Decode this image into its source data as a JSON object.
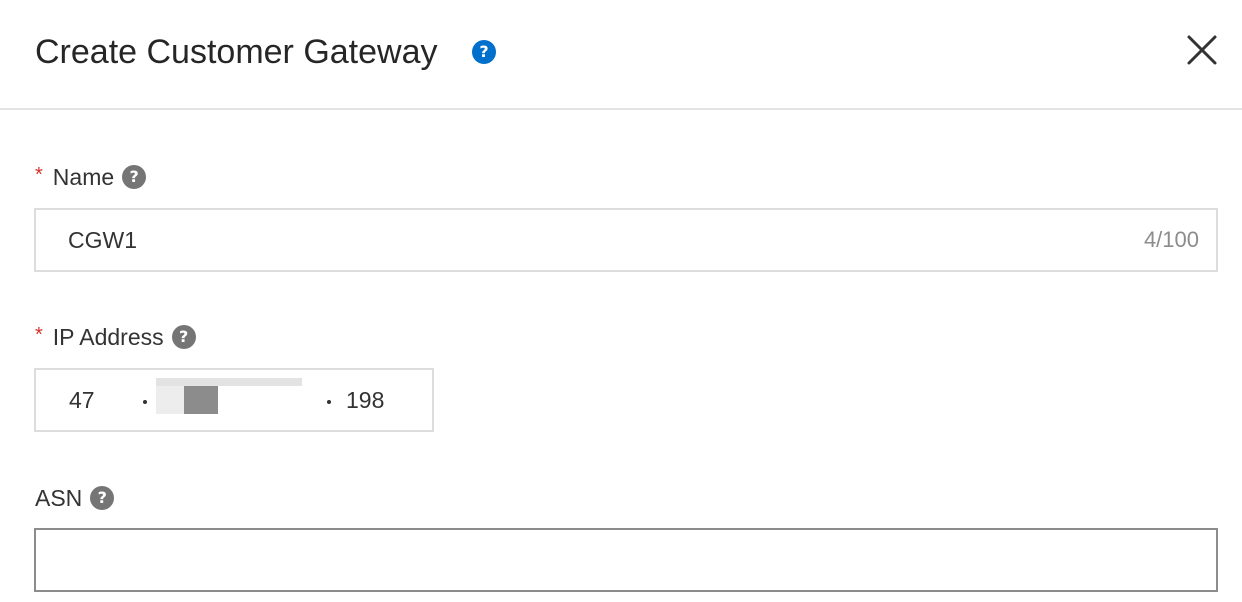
{
  "dialog": {
    "title": "Create Customer Gateway",
    "help_icon": "question-circle-icon",
    "close_icon": "close-icon",
    "accent_color": "#0070cc"
  },
  "form": {
    "name": {
      "label": "Name",
      "required": "*",
      "value": "CGW1",
      "counter": "4/100"
    },
    "ip_address": {
      "label": "IP Address",
      "required": "*",
      "segments": [
        "47",
        "",
        "",
        "198"
      ]
    },
    "asn": {
      "label": "ASN",
      "value": ""
    }
  }
}
